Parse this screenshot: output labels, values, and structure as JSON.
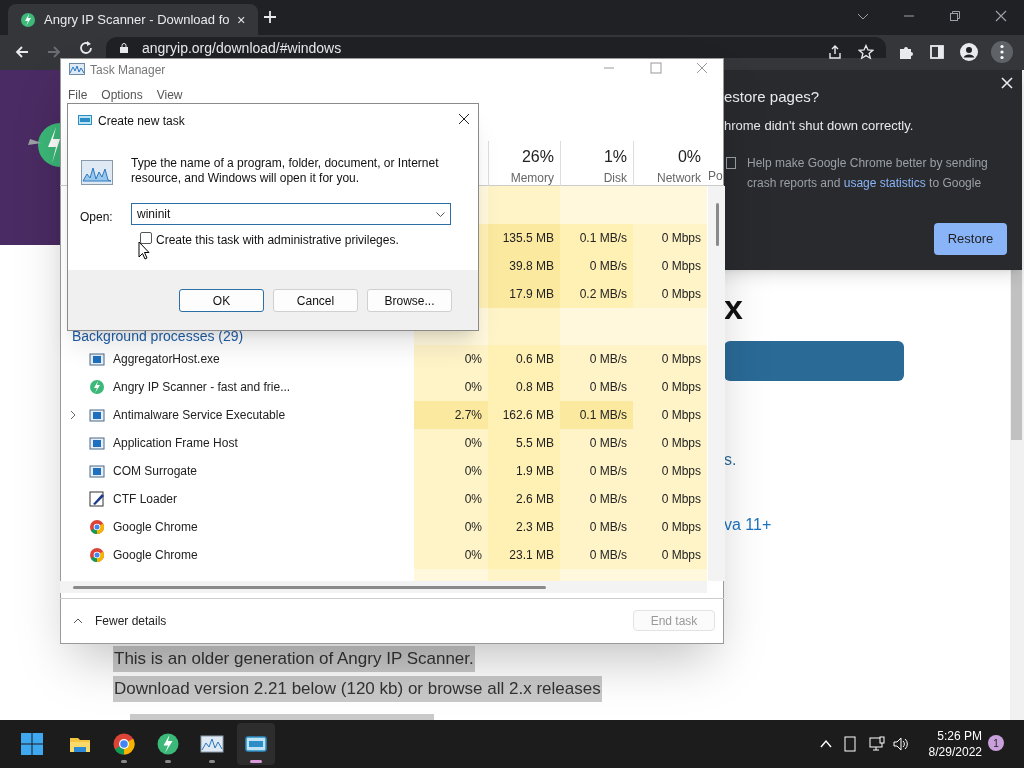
{
  "browser": {
    "tab_title": "Angry IP Scanner - Download fo",
    "url": "angryip.org/download/#windows"
  },
  "task_manager": {
    "title": "Task Manager",
    "menu": [
      "File",
      "Options",
      "View"
    ],
    "columns": [
      {
        "percent": "26%",
        "label": "Memory"
      },
      {
        "percent": "1%",
        "label": "Disk"
      },
      {
        "percent": "0%",
        "label": "Network"
      },
      {
        "label": "Po"
      }
    ],
    "app_rows": [
      {
        "memory": "135.5 MB",
        "disk": "0.1 MB/s",
        "network": "0 Mbps"
      },
      {
        "memory": "39.8 MB",
        "disk": "0 MB/s",
        "network": "0 Mbps"
      },
      {
        "memory": "17.9 MB",
        "disk": "0.2 MB/s",
        "network": "0 Mbps"
      }
    ],
    "group_header": "Background processes (29)",
    "rows": [
      {
        "kind": "app",
        "name": "AggregatorHost.exe",
        "expandable": false,
        "cpu": "0%",
        "memory": "0.6 MB",
        "disk": "0 MB/s",
        "network": "0 Mbps"
      },
      {
        "kind": "scanner",
        "name": "Angry IP Scanner - fast and frie...",
        "expandable": false,
        "cpu": "0%",
        "memory": "0.8 MB",
        "disk": "0 MB/s",
        "network": "0 Mbps"
      },
      {
        "kind": "app",
        "name": "Antimalware Service Executable",
        "expandable": true,
        "cpu": "2.7%",
        "memory": "162.6 MB",
        "disk": "0.1 MB/s",
        "network": "0 Mbps"
      },
      {
        "kind": "app",
        "name": "Application Frame Host",
        "expandable": false,
        "cpu": "0%",
        "memory": "5.5 MB",
        "disk": "0 MB/s",
        "network": "0 Mbps"
      },
      {
        "kind": "app",
        "name": "COM Surrogate",
        "expandable": false,
        "cpu": "0%",
        "memory": "1.9 MB",
        "disk": "0 MB/s",
        "network": "0 Mbps"
      },
      {
        "kind": "editor",
        "name": "CTF Loader",
        "expandable": false,
        "cpu": "0%",
        "memory": "2.6 MB",
        "disk": "0 MB/s",
        "network": "0 Mbps"
      },
      {
        "kind": "chrome",
        "name": "Google Chrome",
        "expandable": false,
        "cpu": "0%",
        "memory": "2.3 MB",
        "disk": "0 MB/s",
        "network": "0 Mbps"
      },
      {
        "kind": "chrome",
        "name": "Google Chrome",
        "expandable": false,
        "cpu": "0%",
        "memory": "23.1 MB",
        "disk": "0 MB/s",
        "network": "0 Mbps"
      }
    ],
    "fewer_details": "Fewer details",
    "end_task": {
      "label": "End task",
      "disabled": true
    }
  },
  "dialog": {
    "title": "Create new task",
    "message": "Type the name of a program, folder, document, or Internet resource, and Windows will open it for you.",
    "open_label": "Open:",
    "open_value": "wininit",
    "admin_checkbox": {
      "label": "Create this task with administrative privileges.",
      "checked": false
    },
    "buttons": [
      {
        "label": "OK",
        "default": true
      },
      {
        "label": "Cancel",
        "default": false
      },
      {
        "label": "Browse...",
        "default": false
      }
    ]
  },
  "restore_popup": {
    "title": "estore pages?",
    "message": "hrome didn't shut down correctly.",
    "consent_checked": false,
    "consent_before": "Help make Google Chrome better by sending crash reports and",
    "consent_link": "usage statistics",
    "consent_after": "to Google",
    "button": "Restore"
  },
  "page": {
    "heading": "x",
    "text_fragment": "s.",
    "link_fragment": "va 11+",
    "paragraphs": [
      "This is an older generation of Angry IP Scanner.",
      "Download version 2.21 below (120 kb) or browse all 2.x releases"
    ]
  },
  "taskbar": {
    "apps": [
      {
        "kind": "explorer",
        "running": false,
        "active": false
      },
      {
        "kind": "chrome",
        "running": true,
        "active": false
      },
      {
        "kind": "scanner",
        "running": true,
        "active": false
      },
      {
        "kind": "monitor",
        "running": true,
        "active": false
      },
      {
        "kind": "run",
        "running": true,
        "active": true
      }
    ],
    "time": "5:26 PM",
    "date": "8/29/2022",
    "notifications": "1"
  }
}
